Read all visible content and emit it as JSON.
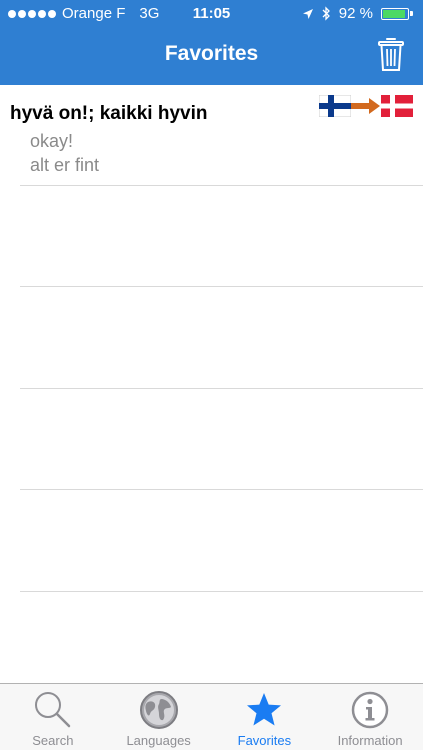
{
  "status_bar": {
    "carrier": "Orange F",
    "network": "3G",
    "time": "11:05",
    "battery": "92 %",
    "battery_level": 0.92
  },
  "nav": {
    "title": "Favorites"
  },
  "favorites": [
    {
      "phrase": "hyvä on!; kaikki hyvin",
      "translations": [
        "okay!",
        "alt er fint"
      ],
      "from_flag": "finland-flag-icon",
      "to_flag": "denmark-flag-icon"
    }
  ],
  "tabs": [
    {
      "label": "Search",
      "icon": "search-icon",
      "active": false
    },
    {
      "label": "Languages",
      "icon": "globe-icon",
      "active": false
    },
    {
      "label": "Favorites",
      "icon": "star-icon",
      "active": true
    },
    {
      "label": "Information",
      "icon": "info-icon",
      "active": false
    }
  ],
  "colors": {
    "nav_bar": "#2f7fd2",
    "tab_active": "#1a7cf2",
    "tab_inactive": "#8e8e93",
    "battery_fill": "#4cd964"
  }
}
